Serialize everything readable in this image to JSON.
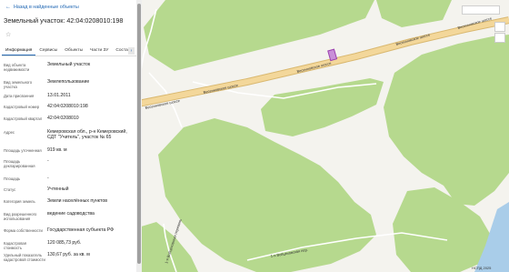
{
  "panel": {
    "back_link": "Назад в найденные объекты",
    "title": "Земельный участок: 42:04:0208010:198",
    "star_icon": "star-outline-icon",
    "tabs": [
      {
        "label": "Информация",
        "active": true
      },
      {
        "label": "Сервисы",
        "active": false
      },
      {
        "label": "Объекты",
        "active": false
      },
      {
        "label": "Части ЗУ",
        "active": false
      },
      {
        "label": "Состав",
        "active": false
      }
    ],
    "tab_next": "›",
    "rows": [
      {
        "label": "Вид объекта недвижимости",
        "value": "Земельный участок"
      },
      {
        "label": "Вид земельного участка",
        "value": "Землепользование"
      },
      {
        "label": "Дата присвоения",
        "value": "13.01.2011"
      },
      {
        "label": "Кадастровый номер",
        "value": "42:04:0208010:198"
      },
      {
        "label": "Кадастровый квартал",
        "value": "42:04:0208010"
      },
      {
        "label": "Адрес",
        "value": "Кемеровская обл., р-н Кемеровский, СДТ \"Учитель\", участок № 65"
      },
      {
        "label": "Площадь уточненная",
        "value": "919 кв. м"
      },
      {
        "label": "Площадь декларированная",
        "value": "-"
      },
      {
        "label": "Площадь",
        "value": "-"
      },
      {
        "label": "Статус",
        "value": "Учтенный"
      },
      {
        "label": "Категория земель",
        "value": "Земли населённых пунктов"
      },
      {
        "label": "Вид разрешенного использования",
        "value": "ведение садоводства"
      },
      {
        "label": "Форма собственности",
        "value": "Государственная субъекта РФ"
      },
      {
        "label": "Кадастровая стоимость",
        "value": "120 085,73 руб."
      },
      {
        "label": "Удельный показатель кадастровой стоимости",
        "value": "130,67 руб. за кв. м"
      }
    ]
  },
  "map": {
    "road_labels": [
      "Весенновское шоссе",
      "Весенновское шоссе",
      "Весенновское шоссе",
      "Весенновское шоссе",
      "Весенновское шоссе",
      "1-я Войцеховская перевень",
      "1-я Войцеховская пер."
    ],
    "copyright": "НСПД 2025",
    "colors": {
      "forest": "#b6d98e",
      "road": "#f3d79a",
      "road_border": "#d9b870",
      "background": "#f4f3ee",
      "water": "#a9cde9",
      "parcel": "#9b3fb0"
    }
  }
}
